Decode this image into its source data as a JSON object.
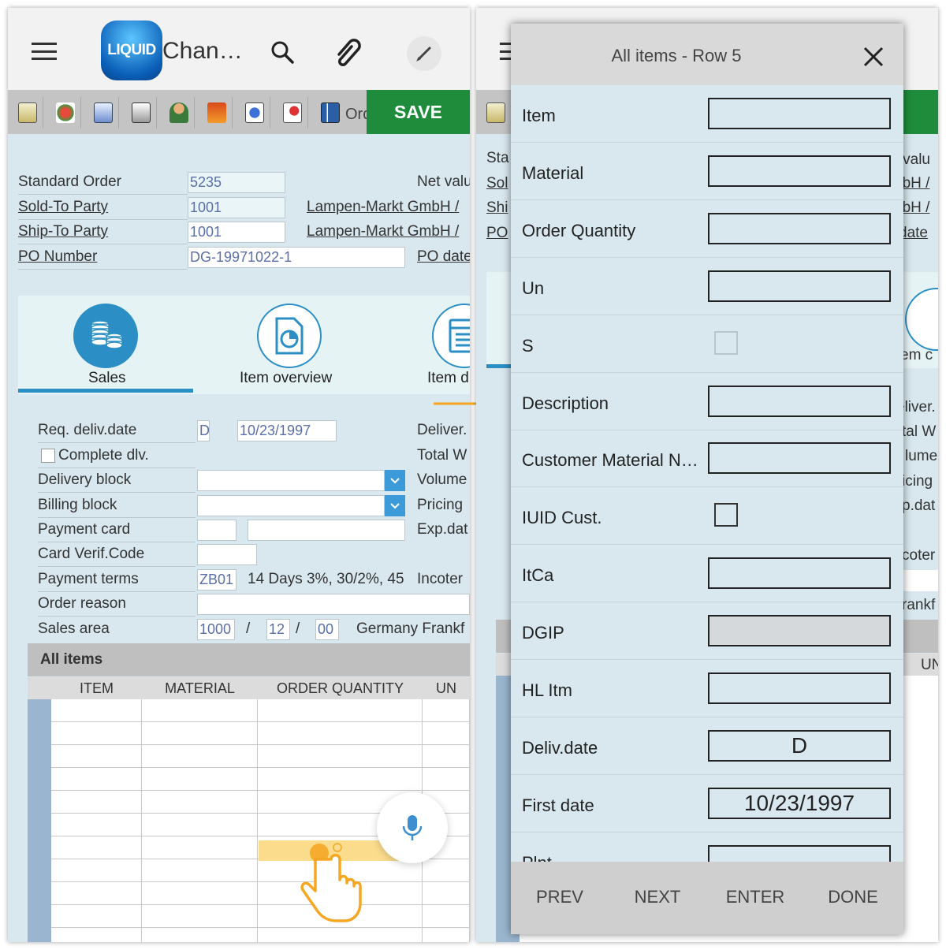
{
  "left": {
    "app_title": "Chan…",
    "logo_text": "LIQUID",
    "toolbar": {
      "order_label": "Ord",
      "save_label": "SAVE"
    },
    "header_fields": {
      "standard_order_label": "Standard Order",
      "standard_order_value": "5235",
      "net_value_label": "Net valu",
      "sold_to_label": "Sold-To Party",
      "sold_to_value": "1001",
      "sold_to_name": "Lampen-Markt GmbH /",
      "ship_to_label": "Ship-To Party",
      "ship_to_value": "1001",
      "ship_to_name": "Lampen-Markt GmbH /",
      "po_number_label": "PO Number",
      "po_number_value": "DG-19971022-1",
      "po_date_label": "PO date"
    },
    "tabs": [
      {
        "label": "Sales",
        "icon": "coins-icon"
      },
      {
        "label": "Item overview",
        "icon": "chart-doc-icon"
      },
      {
        "label": "Item d",
        "icon": "list-doc-icon"
      }
    ],
    "sales": {
      "req_deliv_label": "Req. deliv.date",
      "req_deliv_type": "D",
      "req_deliv_value": "10/23/1997",
      "deliver_label": "Deliver.",
      "complete_dlv_label": "Complete dlv.",
      "total_label": "Total W",
      "delivery_block_label": "Delivery block",
      "volume_label": "Volume",
      "billing_block_label": "Billing block",
      "pricing_label": "Pricing",
      "payment_card_label": "Payment card",
      "exp_date_label": "Exp.dat",
      "card_verif_label": "Card Verif.Code",
      "payment_terms_label": "Payment terms",
      "payment_terms_code": "ZB01",
      "payment_terms_text": "14 Days 3%, 30/2%, 45",
      "incoterms_label": "Incoter",
      "order_reason_label": "Order reason",
      "sales_area_label": "Sales area",
      "sales_area_org": "1000",
      "sales_area_sep": "/",
      "sales_area_channel": "12",
      "sales_area_division": "00",
      "sales_area_text": "Germany Frankf"
    },
    "grid": {
      "title": "All items",
      "columns": [
        "ITEM",
        "MATERIAL",
        "ORDER QUANTITY",
        "UN"
      ]
    }
  },
  "right": {
    "bg_fragments": {
      "standard": "Sta",
      "sold": "Sol",
      "ship": "Shi",
      "po": "PO",
      "net_value": "et valu",
      "sold_name": "nbH /",
      "ship_name": "nbH /",
      "po_date": "date",
      "item_tab": "em c",
      "deliver": "eliver.",
      "total": "tal W",
      "volume": "lume",
      "pricing": "icing",
      "exp_date": "p.dat",
      "incoter": "coter",
      "frankf": "rankf",
      "un": "UN"
    },
    "modal": {
      "title": "All items - Row 5",
      "fields": [
        {
          "label": "Item",
          "type": "input",
          "value": ""
        },
        {
          "label": "Material",
          "type": "input",
          "value": ""
        },
        {
          "label": "Order Quantity",
          "type": "input",
          "value": ""
        },
        {
          "label": "Un",
          "type": "input",
          "value": ""
        },
        {
          "label": "S",
          "type": "checkbox-disabled",
          "value": ""
        },
        {
          "label": "Description",
          "type": "input",
          "value": ""
        },
        {
          "label": "Customer Material N…",
          "type": "input",
          "value": ""
        },
        {
          "label": "IUID Cust.",
          "type": "checkbox",
          "value": ""
        },
        {
          "label": "ItCa",
          "type": "input",
          "value": ""
        },
        {
          "label": "DGIP",
          "type": "input-grey",
          "value": ""
        },
        {
          "label": "HL Itm",
          "type": "input",
          "value": ""
        },
        {
          "label": "Deliv.date",
          "type": "input",
          "value": "D"
        },
        {
          "label": "First date",
          "type": "input",
          "value": "10/23/1997"
        },
        {
          "label": "Plnt",
          "type": "input",
          "value": ""
        }
      ],
      "footer": [
        "PREV",
        "NEXT",
        "ENTER",
        "DONE"
      ]
    }
  },
  "colors": {
    "save_green": "#1f8c3c",
    "accent_blue": "#2b8fc6",
    "panel_bg": "#d8e8ee",
    "highlight_yellow": "#fbdc8c",
    "arrow_orange": "#f5a623"
  }
}
